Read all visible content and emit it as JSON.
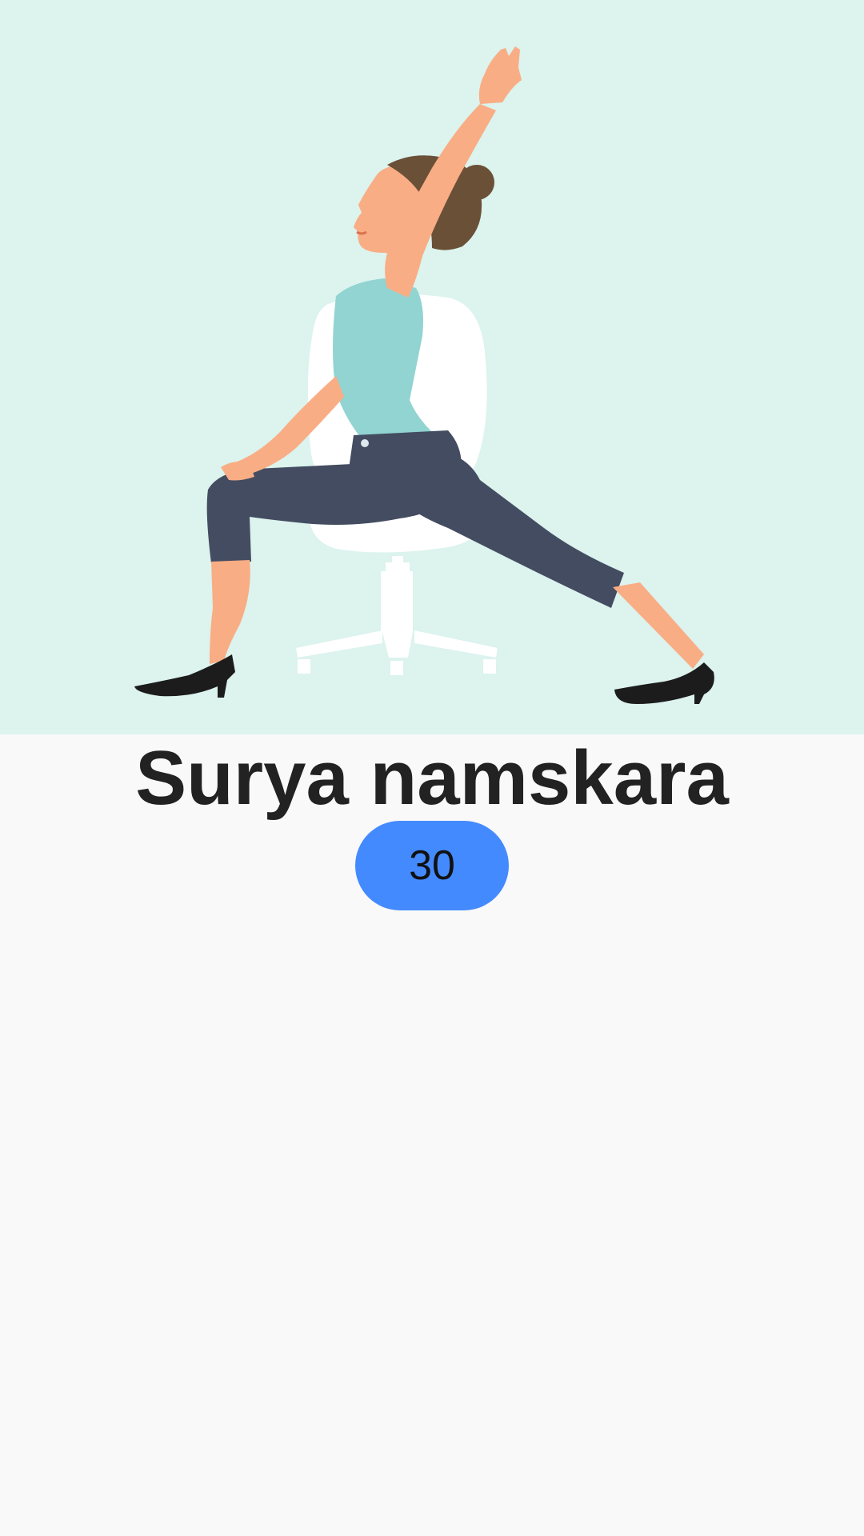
{
  "exercise": {
    "name": "Surya namskara",
    "illustration_icon": "person-chair-stretch-illustration",
    "timer_value": "30"
  },
  "colors": {
    "hero_background": "#dcf3ee",
    "page_background": "#f9f9f9",
    "timer_pill": "#448aff",
    "title_text": "#222222"
  }
}
